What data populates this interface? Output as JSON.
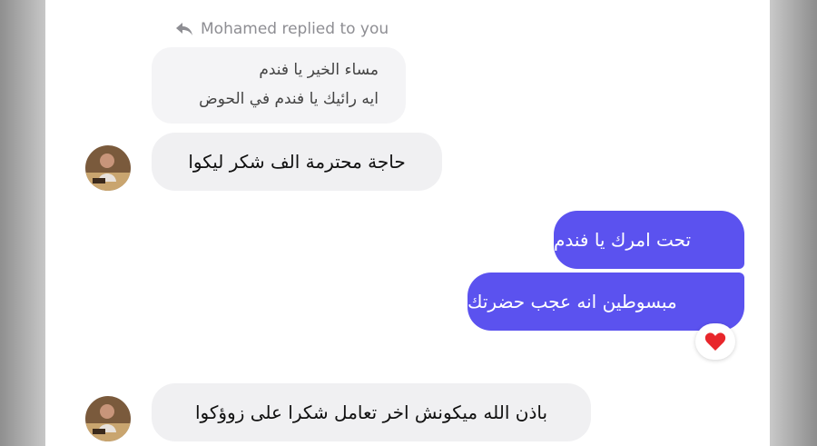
{
  "reply_header": {
    "text": "Mohamed replied to you",
    "icon": "reply-arrow-icon"
  },
  "quoted_message": {
    "lines": [
      "مساء الخير يا فندم",
      "ايه رائيك يا فندم في الحوض"
    ]
  },
  "messages": [
    {
      "direction": "incoming",
      "text": "حاجة محترمة الف شكر ليكوا"
    },
    {
      "direction": "outgoing",
      "text": "تحت امرك يا فندم"
    },
    {
      "direction": "outgoing",
      "text": "مبسوطين انه عجب حضرتك"
    },
    {
      "direction": "incoming",
      "text": "باذن الله ميكونش اخر تعامل شكرا على زوؤكوا"
    }
  ],
  "reaction": {
    "icon": "heart-icon",
    "color": "#e8262b"
  },
  "colors": {
    "outgoing_bubble": "#5b52ef",
    "incoming_bubble": "#f0f0f2",
    "meta_text": "#8e8e93"
  }
}
